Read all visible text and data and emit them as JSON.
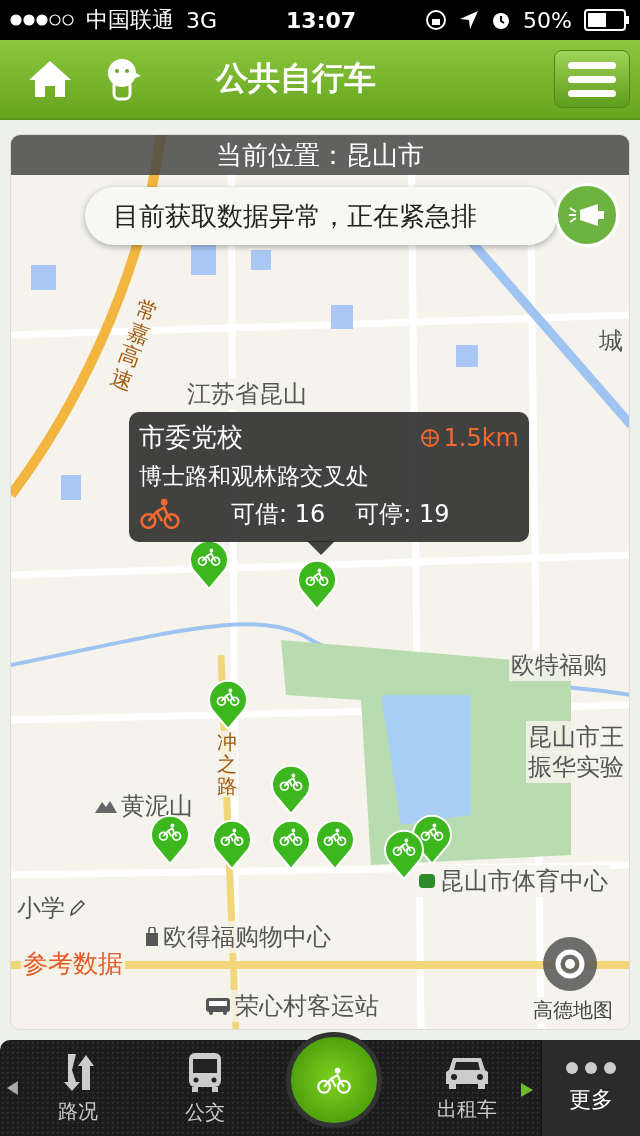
{
  "status_bar": {
    "carrier": "中国联通",
    "network": "3G",
    "time": "13:07",
    "battery_text": "50%"
  },
  "header": {
    "title": "公共自行车"
  },
  "location_bar": {
    "text": "当前位置：昆山市"
  },
  "notice": {
    "text": "目前获取数据异常，正在紧急排"
  },
  "map_labels": [
    "城",
    "江苏省昆山",
    "欧特福购",
    "昆山市王",
    "振华实验",
    "黄泥山",
    "昆山市体育中心",
    "小学",
    "欧得福购物中心",
    "荣心村客运站",
    "冲之路",
    "常嘉高速"
  ],
  "map_overlay": {
    "reference": "参考数据",
    "provider": "高德地图"
  },
  "station_popup": {
    "name": "市委党校",
    "distance": "1.5km",
    "address": "博士路和观林路交叉处",
    "borrow": "可借: 16",
    "park": "可停: 19"
  },
  "tabs": [
    {
      "kind": "traffic",
      "label": "路况",
      "selected": false
    },
    {
      "kind": "bus",
      "label": "公交",
      "selected": false
    },
    {
      "kind": "bike",
      "selected": true
    },
    {
      "kind": "taxi",
      "label": "出租车",
      "selected": false
    },
    {
      "kind": "more",
      "label": "更多",
      "selected": false
    }
  ]
}
